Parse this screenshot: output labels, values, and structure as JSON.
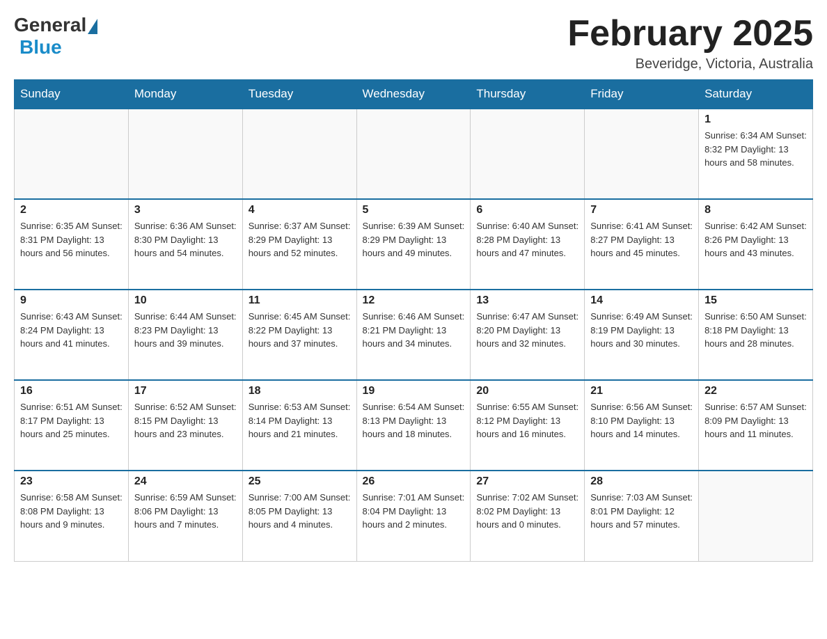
{
  "logo": {
    "general": "General",
    "blue": "Blue"
  },
  "title": "February 2025",
  "location": "Beveridge, Victoria, Australia",
  "days_of_week": [
    "Sunday",
    "Monday",
    "Tuesday",
    "Wednesday",
    "Thursday",
    "Friday",
    "Saturday"
  ],
  "weeks": [
    [
      {
        "day": "",
        "info": ""
      },
      {
        "day": "",
        "info": ""
      },
      {
        "day": "",
        "info": ""
      },
      {
        "day": "",
        "info": ""
      },
      {
        "day": "",
        "info": ""
      },
      {
        "day": "",
        "info": ""
      },
      {
        "day": "1",
        "info": "Sunrise: 6:34 AM\nSunset: 8:32 PM\nDaylight: 13 hours and 58 minutes."
      }
    ],
    [
      {
        "day": "2",
        "info": "Sunrise: 6:35 AM\nSunset: 8:31 PM\nDaylight: 13 hours and 56 minutes."
      },
      {
        "day": "3",
        "info": "Sunrise: 6:36 AM\nSunset: 8:30 PM\nDaylight: 13 hours and 54 minutes."
      },
      {
        "day": "4",
        "info": "Sunrise: 6:37 AM\nSunset: 8:29 PM\nDaylight: 13 hours and 52 minutes."
      },
      {
        "day": "5",
        "info": "Sunrise: 6:39 AM\nSunset: 8:29 PM\nDaylight: 13 hours and 49 minutes."
      },
      {
        "day": "6",
        "info": "Sunrise: 6:40 AM\nSunset: 8:28 PM\nDaylight: 13 hours and 47 minutes."
      },
      {
        "day": "7",
        "info": "Sunrise: 6:41 AM\nSunset: 8:27 PM\nDaylight: 13 hours and 45 minutes."
      },
      {
        "day": "8",
        "info": "Sunrise: 6:42 AM\nSunset: 8:26 PM\nDaylight: 13 hours and 43 minutes."
      }
    ],
    [
      {
        "day": "9",
        "info": "Sunrise: 6:43 AM\nSunset: 8:24 PM\nDaylight: 13 hours and 41 minutes."
      },
      {
        "day": "10",
        "info": "Sunrise: 6:44 AM\nSunset: 8:23 PM\nDaylight: 13 hours and 39 minutes."
      },
      {
        "day": "11",
        "info": "Sunrise: 6:45 AM\nSunset: 8:22 PM\nDaylight: 13 hours and 37 minutes."
      },
      {
        "day": "12",
        "info": "Sunrise: 6:46 AM\nSunset: 8:21 PM\nDaylight: 13 hours and 34 minutes."
      },
      {
        "day": "13",
        "info": "Sunrise: 6:47 AM\nSunset: 8:20 PM\nDaylight: 13 hours and 32 minutes."
      },
      {
        "day": "14",
        "info": "Sunrise: 6:49 AM\nSunset: 8:19 PM\nDaylight: 13 hours and 30 minutes."
      },
      {
        "day": "15",
        "info": "Sunrise: 6:50 AM\nSunset: 8:18 PM\nDaylight: 13 hours and 28 minutes."
      }
    ],
    [
      {
        "day": "16",
        "info": "Sunrise: 6:51 AM\nSunset: 8:17 PM\nDaylight: 13 hours and 25 minutes."
      },
      {
        "day": "17",
        "info": "Sunrise: 6:52 AM\nSunset: 8:15 PM\nDaylight: 13 hours and 23 minutes."
      },
      {
        "day": "18",
        "info": "Sunrise: 6:53 AM\nSunset: 8:14 PM\nDaylight: 13 hours and 21 minutes."
      },
      {
        "day": "19",
        "info": "Sunrise: 6:54 AM\nSunset: 8:13 PM\nDaylight: 13 hours and 18 minutes."
      },
      {
        "day": "20",
        "info": "Sunrise: 6:55 AM\nSunset: 8:12 PM\nDaylight: 13 hours and 16 minutes."
      },
      {
        "day": "21",
        "info": "Sunrise: 6:56 AM\nSunset: 8:10 PM\nDaylight: 13 hours and 14 minutes."
      },
      {
        "day": "22",
        "info": "Sunrise: 6:57 AM\nSunset: 8:09 PM\nDaylight: 13 hours and 11 minutes."
      }
    ],
    [
      {
        "day": "23",
        "info": "Sunrise: 6:58 AM\nSunset: 8:08 PM\nDaylight: 13 hours and 9 minutes."
      },
      {
        "day": "24",
        "info": "Sunrise: 6:59 AM\nSunset: 8:06 PM\nDaylight: 13 hours and 7 minutes."
      },
      {
        "day": "25",
        "info": "Sunrise: 7:00 AM\nSunset: 8:05 PM\nDaylight: 13 hours and 4 minutes."
      },
      {
        "day": "26",
        "info": "Sunrise: 7:01 AM\nSunset: 8:04 PM\nDaylight: 13 hours and 2 minutes."
      },
      {
        "day": "27",
        "info": "Sunrise: 7:02 AM\nSunset: 8:02 PM\nDaylight: 13 hours and 0 minutes."
      },
      {
        "day": "28",
        "info": "Sunrise: 7:03 AM\nSunset: 8:01 PM\nDaylight: 12 hours and 57 minutes."
      },
      {
        "day": "",
        "info": ""
      }
    ]
  ]
}
